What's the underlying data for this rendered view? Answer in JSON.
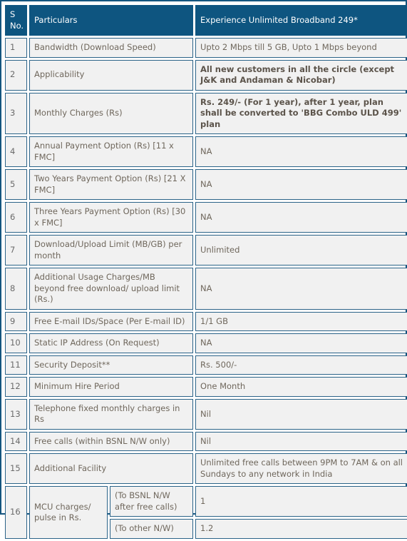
{
  "table": {
    "columns": [
      {
        "key": "sno",
        "label": "S\nNo."
      },
      {
        "key": "particulars",
        "label": "Particulars"
      },
      {
        "key": "plan",
        "label": "Experience Unlimited Broadband 249*"
      }
    ],
    "header": {
      "sno_line1": "S",
      "sno_line2": "No.",
      "particulars": "Particulars",
      "plan": "Experience Unlimited Broadband 249*"
    },
    "rows": [
      {
        "sno": "1",
        "particulars": "Bandwidth (Download Speed)",
        "value": "Upto 2 Mbps till 5 GB, Upto 1 Mbps beyond",
        "value_bold": false
      },
      {
        "sno": "2",
        "particulars": "Applicability",
        "value": "All new customers in all the circle (except J&K and Andaman & Nicobar)",
        "value_bold": true
      },
      {
        "sno": "3",
        "particulars": "Monthly Charges (Rs)",
        "value": "Rs. 249/- (For 1  year), after 1 year, plan shall be converted to 'BBG Combo ULD 499' plan",
        "value_bold": true
      },
      {
        "sno": "4",
        "particulars": "Annual Payment Option (Rs) [11 x FMC]",
        "value": "NA",
        "value_bold": false
      },
      {
        "sno": "5",
        "particulars": "Two Years Payment Option (Rs) [21 X FMC]",
        "value": "NA",
        "value_bold": false
      },
      {
        "sno": "6",
        "particulars": "Three Years Payment Option (Rs) [30 x FMC]",
        "value": "NA",
        "value_bold": false
      },
      {
        "sno": "7",
        "particulars": "Download/Upload Limit (MB/GB) per month",
        "value": "Unlimited",
        "value_bold": false
      },
      {
        "sno": "8",
        "particulars": "Additional Usage Charges/MB beyond free download/ upload limit (Rs.)",
        "value": "NA",
        "value_bold": false
      },
      {
        "sno": "9",
        "particulars": "Free E-mail IDs/Space (Per E-mail ID)",
        "value": "1/1 GB",
        "value_bold": false
      },
      {
        "sno": "10",
        "particulars": "Static IP Address (On Request)",
        "value": "NA",
        "value_bold": false
      },
      {
        "sno": "11",
        "particulars": "Security Deposit**",
        "value": "Rs. 500/-",
        "value_bold": false
      },
      {
        "sno": "12",
        "particulars": "Minimum Hire Period",
        "value": "One Month",
        "value_bold": false
      },
      {
        "sno": "13",
        "particulars": "Telephone fixed monthly charges in Rs",
        "value": "Nil",
        "value_bold": false
      },
      {
        "sno": "14",
        "particulars": "Free calls (within BSNL N/W only)",
        "value": "Nil",
        "value_bold": false
      },
      {
        "sno": "15",
        "particulars": "Additional Facility",
        "value": "Unlimited free calls between 9PM to 7AM & on all Sundays  to any network in India",
        "value_bold": false
      }
    ],
    "mcu_row": {
      "sno": "16",
      "particulars": "MCU charges/ pulse in Rs.",
      "sub_rows": [
        {
          "label": "(To BSNL N/W after free calls)",
          "value": "1"
        },
        {
          "label": "(To other N/W)",
          "value": "1.2"
        }
      ]
    }
  },
  "colors": {
    "header_bg": "#0e5580",
    "header_text": "#ffffff",
    "cell_bg": "#f1f1f1",
    "cell_border": "#2b6388",
    "table_border": "#14557f",
    "body_text": "#6f675c",
    "bold_text": "#5b534a"
  }
}
